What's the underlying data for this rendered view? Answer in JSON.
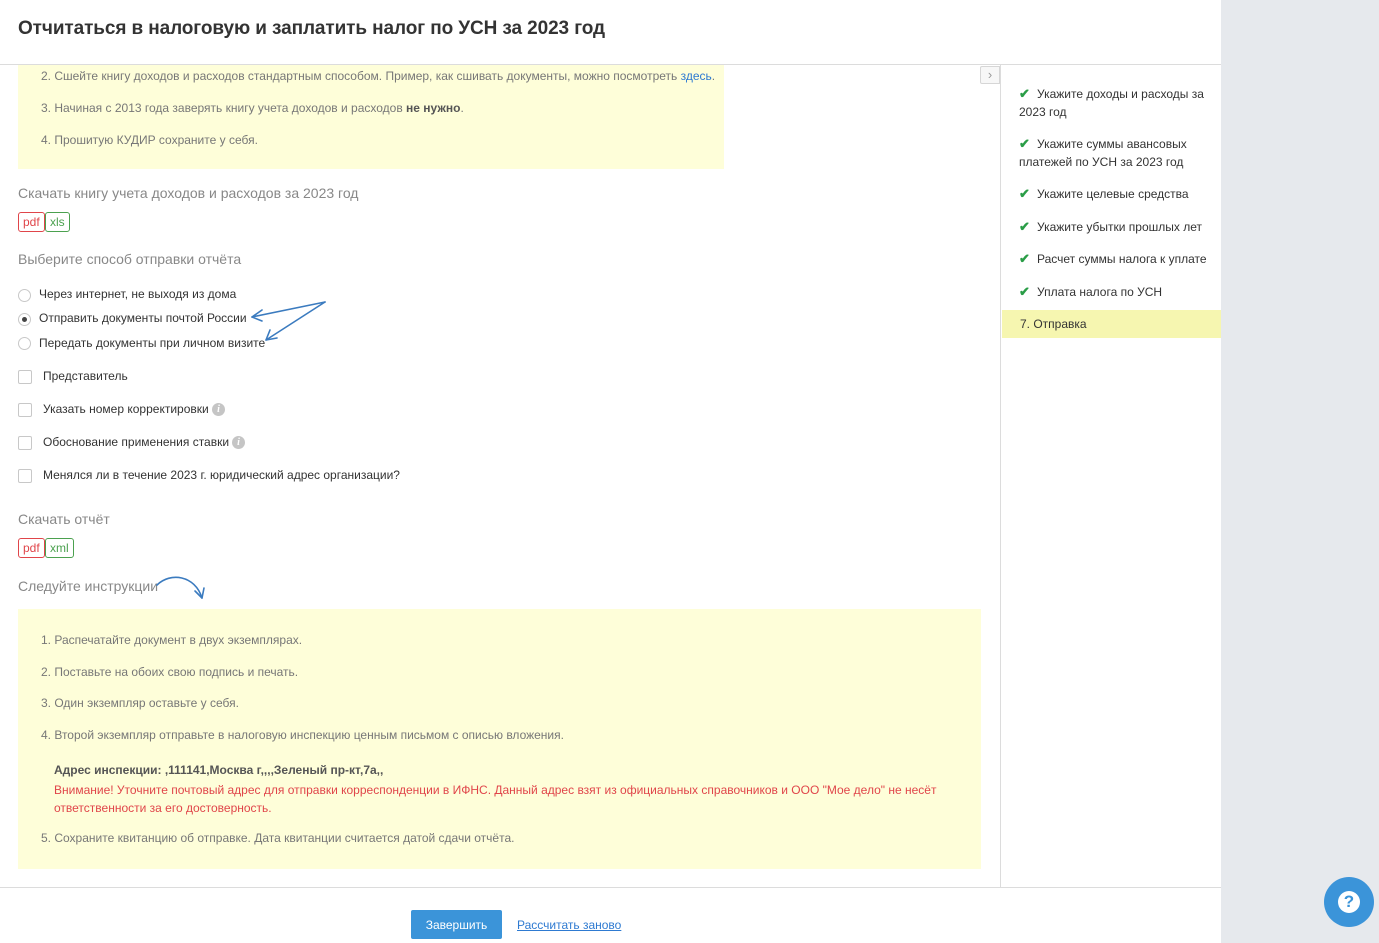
{
  "header": {
    "title": "Отчитаться в налоговую и заплатить налог по УСН за 2023 год"
  },
  "note_top": {
    "item2_text": "2. Сшейте книгу доходов и расходов стандартным способом. Пример, как сшивать документы, можно посмотреть ",
    "item2_link": "здесь",
    "item2_end": ".",
    "item3_text": "3. Начиная с 2013 года заверять книгу учета доходов и расходов ",
    "item3_bold": "не нужно",
    "item3_end": ".",
    "item4_text": "4. Прошитую КУДИР сохраните у себя."
  },
  "kudir": {
    "title": "Скачать книгу учета доходов и расходов за 2023 год",
    "formats": [
      "pdf",
      "xls"
    ]
  },
  "send_method": {
    "title": "Выберите способ отправки отчёта",
    "options": [
      {
        "label": "Через интернет, не выходя из дома",
        "checked": false
      },
      {
        "label": "Отправить документы почтой России",
        "checked": true
      },
      {
        "label": "Передать документы при личном визите",
        "checked": false
      }
    ]
  },
  "checkboxes": [
    {
      "label": "Представитель",
      "info": false
    },
    {
      "label": "Указать номер корректировки",
      "info": true
    },
    {
      "label": "Обоснование применения ставки",
      "info": true
    },
    {
      "label": "Менялся ли в течение 2023 г. юридический адрес организации?",
      "info": false
    }
  ],
  "report": {
    "title": "Скачать отчёт",
    "formats": [
      "pdf",
      "xml"
    ]
  },
  "instructions": {
    "title": "Следуйте инструкции",
    "items": [
      "1. Распечатайте документ в двух экземплярах.",
      "2. Поставьте на обоих свою подпись и печать.",
      "3. Один экземпляр оставьте у себя.",
      "4. Второй экземпляр отправьте в налоговую инспекцию ценным письмом с описью вложения."
    ],
    "address": "Адрес инспекции: ,111141,Москва г,,,,Зеленый пр-кт,7а,,",
    "warning": "Внимание! Уточните почтовый адрес для отправки корреспонденции в ИФНС. Данный адрес взят из официальных справочников и ООО \"Мое дело\" не несёт ответственности за его достоверность.",
    "item5": "5. Сохраните квитанцию об отправке. Дата квитанции считается датой сдачи отчёта."
  },
  "sidebar": {
    "collapse_glyph": "›",
    "steps": [
      {
        "label": "Укажите доходы и расходы за 2023 год",
        "done": true
      },
      {
        "label": "Укажите суммы авансовых платежей по УСН за 2023 год",
        "done": true
      },
      {
        "label": "Укажите целевые средства",
        "done": true
      },
      {
        "label": "Укажите убытки прошлых лет",
        "done": true
      },
      {
        "label": "Расчет суммы налога к уплате",
        "done": true
      },
      {
        "label": "Уплата налога по УСН",
        "done": true
      }
    ],
    "active_step": "7.  Отправка"
  },
  "footer": {
    "finish_label": "Завершить",
    "recalc_label": "Рассчитать заново"
  },
  "help": {
    "glyph": "?"
  },
  "colors": {
    "accent": "#3b94d9",
    "link": "#2e7ad1",
    "note_bg": "#fefed9",
    "active_step_bg": "#f6f6b0",
    "check": "#2a9d47",
    "warning": "#e0454a",
    "annotation_arrow": "#3b7bbf"
  }
}
